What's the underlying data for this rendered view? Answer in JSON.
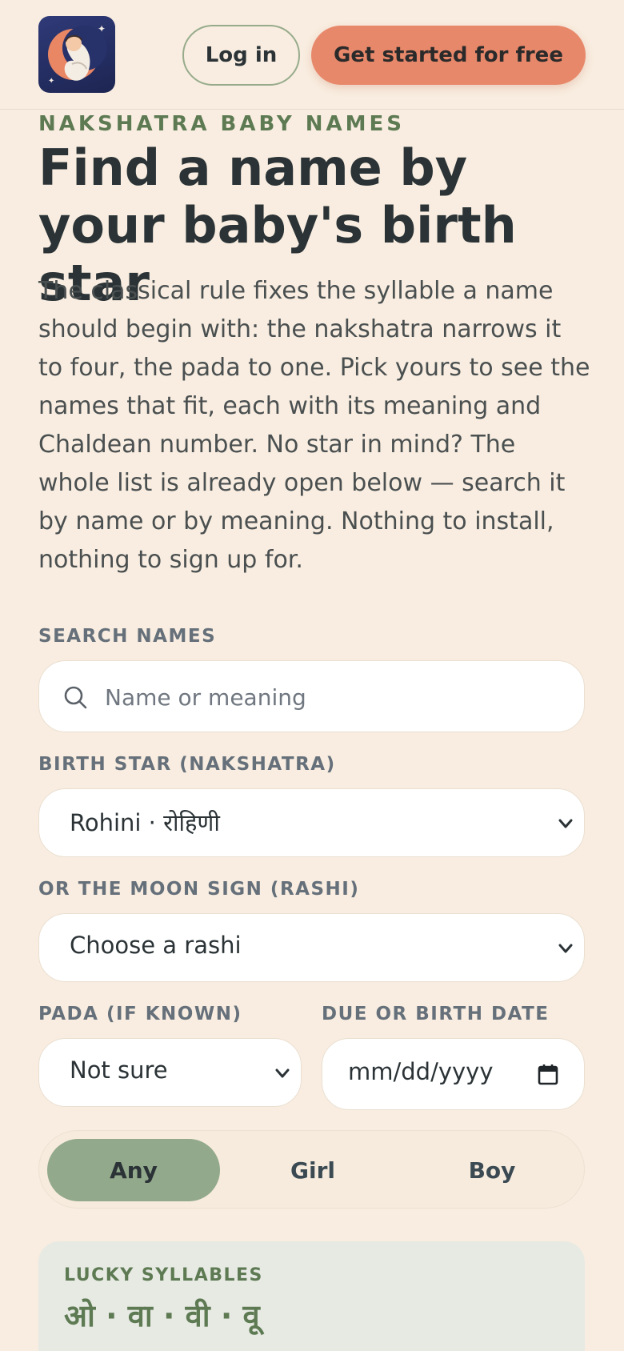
{
  "header": {
    "login_label": "Log in",
    "cta_label": "Get started for free"
  },
  "hero": {
    "eyebrow": "NAKSHATRA BABY NAMES",
    "title": "Find a name by your baby's birth star",
    "intro": "The classical rule fixes the syllable a name should begin with: the nakshatra narrows it to four, the pada to one. Pick yours to see the names that fit, each with its meaning and Chaldean number. No star in mind? The whole list is already open below — search it by name or by meaning. Nothing to install, nothing to sign up for."
  },
  "form": {
    "search_label": "SEARCH NAMES",
    "search_placeholder": "Name or meaning",
    "star_label": "BIRTH STAR (NAKSHATRA)",
    "star_value": "Rohini · रोहिणी",
    "rashi_label": "OR THE MOON SIGN (RASHI)",
    "rashi_value": "Choose a rashi",
    "pada_label": "PADA (IF KNOWN)",
    "pada_value": "Not sure",
    "date_label": "DUE OR BIRTH DATE",
    "date_placeholder": "mm/dd/yyyy"
  },
  "gender": {
    "options": [
      "Any",
      "Girl",
      "Boy"
    ],
    "selected": "Any"
  },
  "lucky": {
    "label": "LUCKY SYLLABLES",
    "syllables": "ओ · वा · वी · वू"
  },
  "icons": {
    "logo": "sleeping-baby-moon-logo",
    "search": "search-icon",
    "dropdown": "chevron-down-icon",
    "date": "calendar-icon"
  },
  "colors": {
    "background": "#f8ede0",
    "accent_green": "#5d7a53",
    "cta": "#e8886b",
    "segment_active": "#92a98b"
  }
}
